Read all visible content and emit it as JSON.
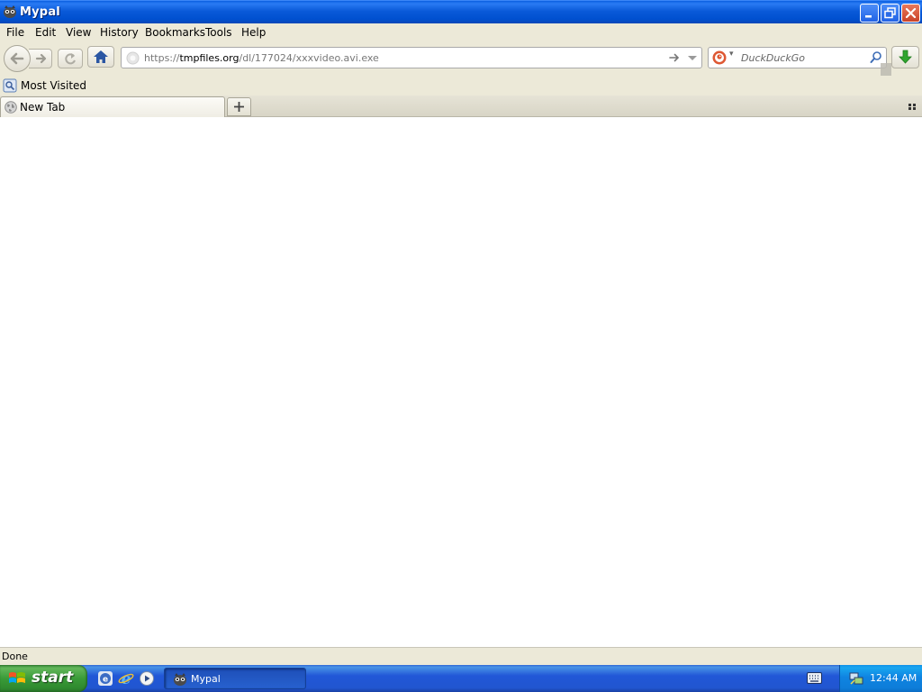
{
  "window": {
    "title": "Mypal",
    "controls": [
      "minimize",
      "restore",
      "close"
    ]
  },
  "menu": {
    "items": [
      "File",
      "Edit",
      "View",
      "History",
      "Bookmarks",
      "Tools",
      "Help"
    ]
  },
  "toolbar": {
    "url_prefix": "https://",
    "url_host": "tmpfiles.org",
    "url_path": "/dl/177024/xxxvideo.avi.exe",
    "search_placeholder": "DuckDuckGo"
  },
  "bookmarks": {
    "most_visited": "Most Visited"
  },
  "tabs": [
    {
      "label": "New Tab",
      "selected": true
    }
  ],
  "status": {
    "text": "Done"
  },
  "taskbar": {
    "start_label": "start",
    "tasks": [
      {
        "label": "Mypal",
        "active": true
      }
    ],
    "clock": "12:44 AM"
  },
  "colors": {
    "titlebar_blue": "#0a5ad8",
    "chrome_beige": "#ece9d8",
    "taskbar_blue": "#2156d0",
    "start_green": "#3a9b38",
    "tray_blue": "#0f84e1"
  }
}
